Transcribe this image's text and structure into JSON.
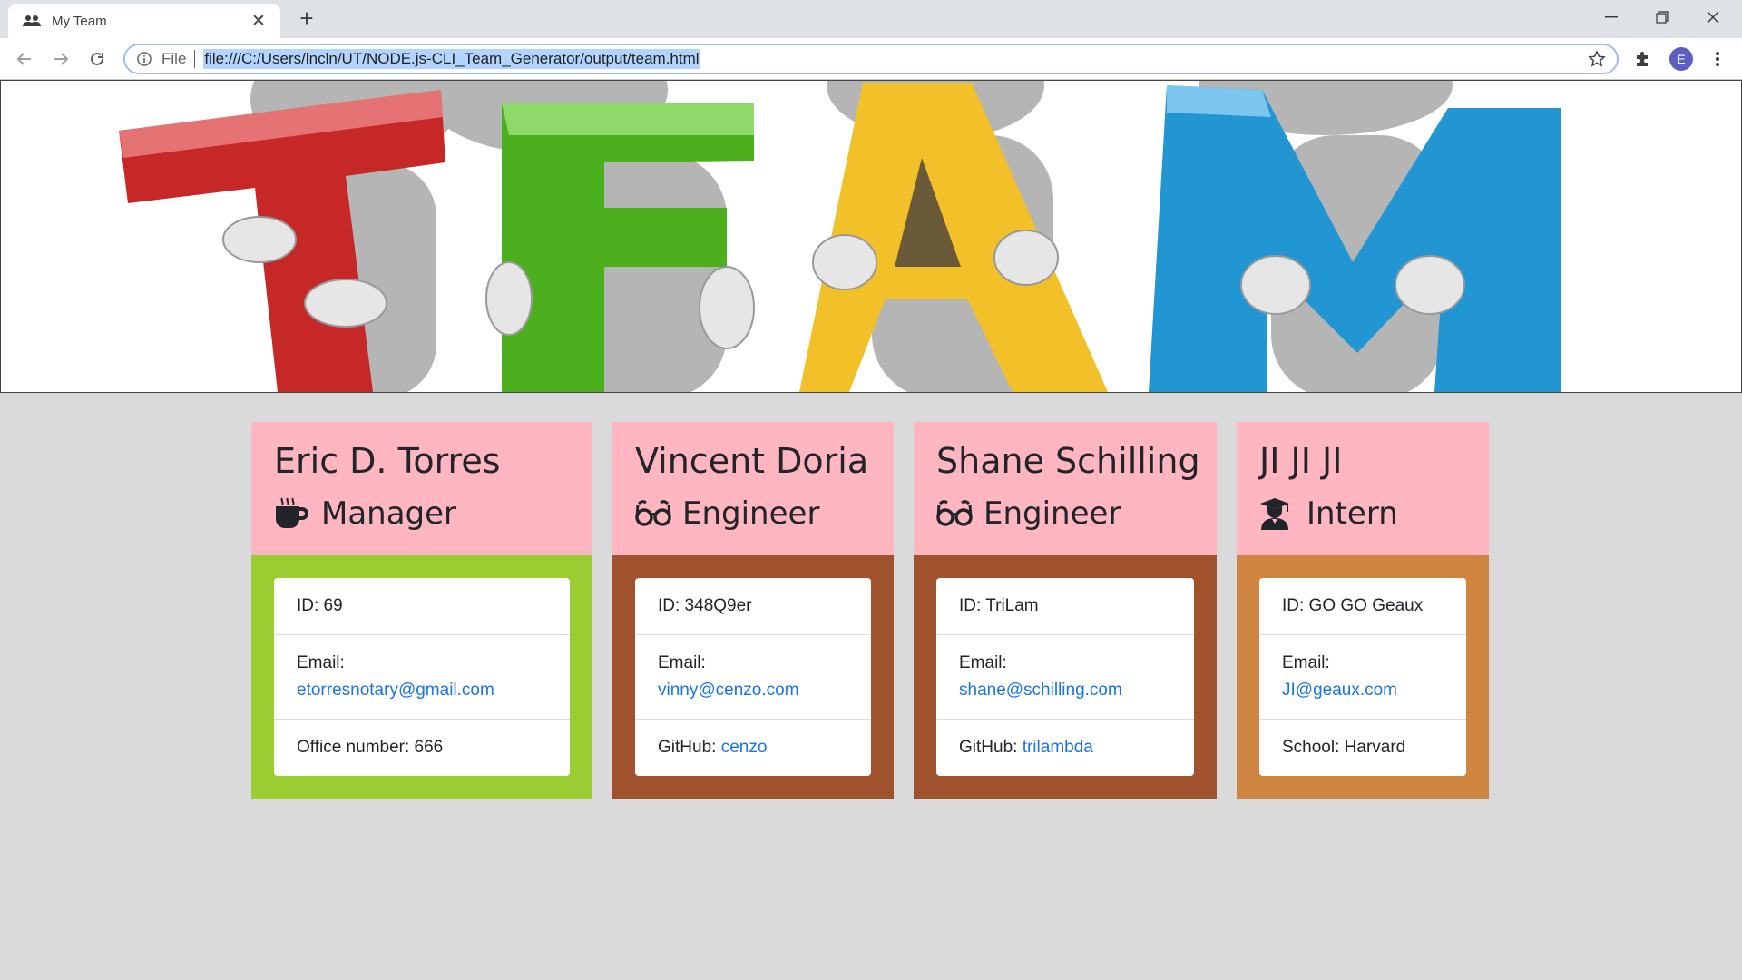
{
  "browser": {
    "tab_title": "My Team",
    "file_label": "File",
    "url": "file:///C:/Users/lncln/UT/NODE.js-CLI_Team_Generator/output/team.html",
    "profile_initial": "E"
  },
  "banner": {
    "letters": [
      "T",
      "E",
      "A",
      "M"
    ],
    "colors": [
      "#c62828",
      "#4caf1e",
      "#f2c029",
      "#2196d3"
    ]
  },
  "team": [
    {
      "name": "Eric D. Torres",
      "role": "Manager",
      "role_icon": "mug-icon",
      "accent": "#9acd32",
      "id_text": "ID: 69",
      "email_label": "Email:",
      "email": "etorresnotary@gmail.com",
      "extra_label": "Office number: 666",
      "extra_link": ""
    },
    {
      "name": "Vincent Doria",
      "role": "Engineer",
      "role_icon": "glasses-icon",
      "accent": "#a0522d",
      "id_text": "ID: 348Q9er",
      "email_label": "Email:",
      "email": "vinny@cenzo.com",
      "extra_label": "GitHub: ",
      "extra_link": "cenzo"
    },
    {
      "name": "Shane Schilling",
      "role": "Engineer",
      "role_icon": "glasses-icon",
      "accent": "#a0522d",
      "id_text": "ID: TriLam",
      "email_label": "Email:",
      "email": "shane@schilling.com",
      "extra_label": "GitHub: ",
      "extra_link": "trilambda"
    },
    {
      "name": "JI JI JI",
      "role": "Intern",
      "role_icon": "graduate-icon",
      "accent": "#cd853f",
      "id_text": "ID: GO GO Geaux",
      "email_label": "Email:",
      "email": "JI@geaux.com",
      "extra_label": "School: Harvard",
      "extra_link": ""
    }
  ]
}
